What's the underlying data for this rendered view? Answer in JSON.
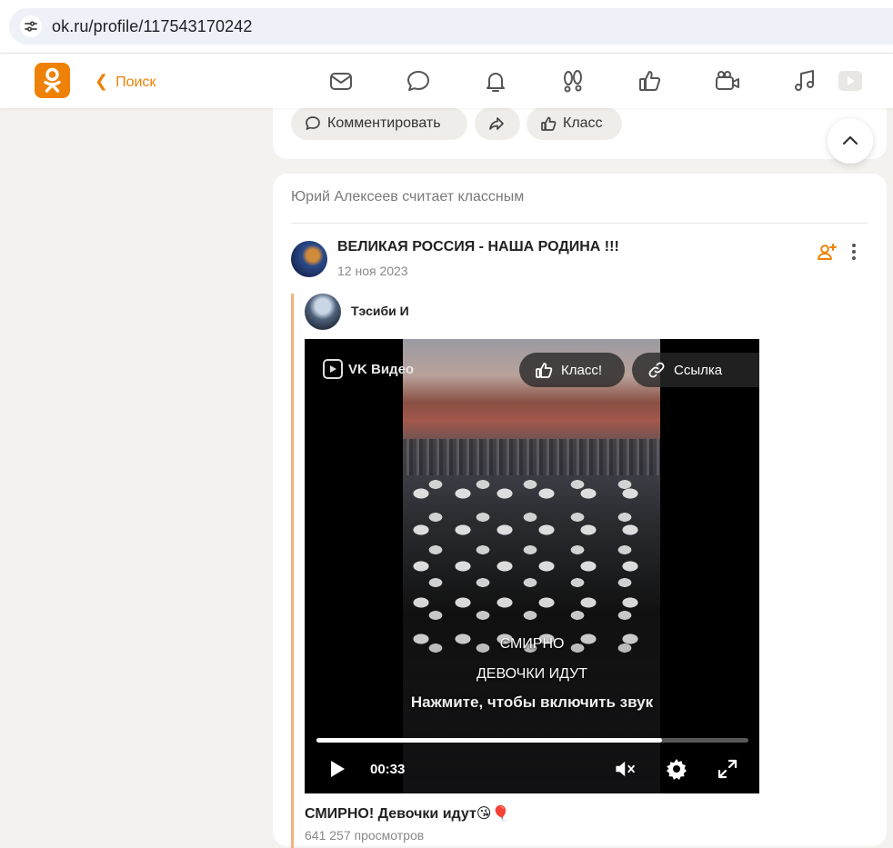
{
  "browser": {
    "url": "ok.ru/profile/117543170242"
  },
  "topnav": {
    "back_label": "Поиск",
    "icons": [
      "mail-icon",
      "discussions-icon",
      "notifications-icon",
      "guests-icon",
      "likes-icon",
      "video-camera-icon",
      "music-icon",
      "video-play-icon"
    ]
  },
  "prev_post": {
    "comment_label": "Комментировать",
    "like_label": "Класс"
  },
  "post": {
    "liked_by": "Юрий Алексеев считает классным",
    "group_name": "ВЕЛИКАЯ РОССИЯ - НАША РОДИНА !!!",
    "date": "12 ноя 2023",
    "author_name": "Тэсиби И",
    "video": {
      "brand": "VK Видео",
      "like_label": "Класс!",
      "link_label": "Ссылка",
      "subtitle_line1": "СМИРНО",
      "subtitle_line2": "ДЕВОЧКИ ИДУТ",
      "sound_hint": "Нажмите, чтобы включить звук",
      "time": "00:33",
      "progress": 0.8
    },
    "title": "СМИРНО! Девочки идут😘🎈",
    "views": "641 257 просмотров"
  },
  "colors": {
    "accent": "#ee8208",
    "repost_bar": "#f4b178"
  }
}
